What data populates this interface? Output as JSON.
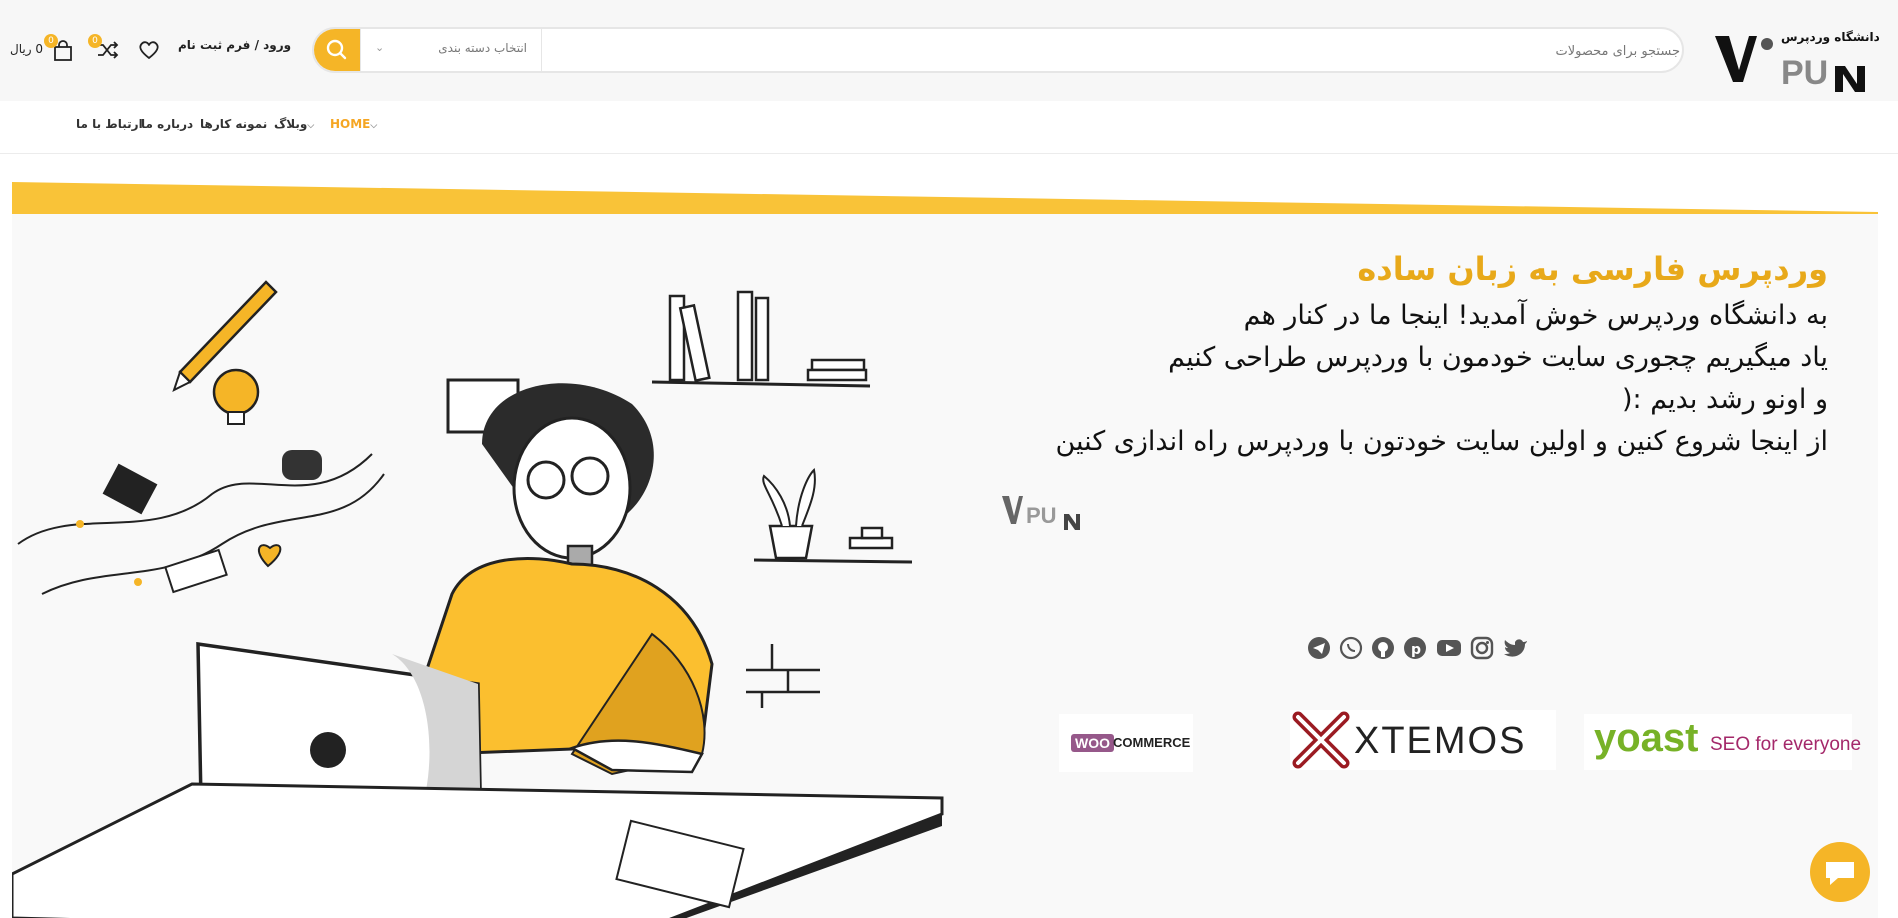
{
  "header": {
    "logo_text": "دانشگاه وردپرس",
    "search": {
      "placeholder": "جستجو برای محصولات",
      "category_label": "انتخاب دسته بندی"
    },
    "login_label": "ورود / فرم ثبت نام",
    "compare_count": "0",
    "cart_count": "0",
    "cart_total": "0 ریال"
  },
  "nav": {
    "items": [
      {
        "label": "HOME",
        "active": true
      },
      {
        "label": "وبلاگ"
      },
      {
        "label": "نمونه کارها"
      },
      {
        "label": "درباره ما"
      },
      {
        "label": "ارتباط با ما"
      }
    ]
  },
  "hero": {
    "title": "وردپرس فارسی به زبان ساده",
    "lines": [
      "به دانشگاه وردپرس خوش آمدید! اینجا ما در کنار هم",
      "یاد میگیریم چجوری سایت خودمون با وردپرس طراحی کنیم",
      "و اونو رشد بدیم :(",
      "از اینجا شروع کنین و اولین سایت خودتون با وردپرس راه اندازی کنین"
    ],
    "social_icons": [
      "telegram-icon",
      "whatsapp-icon",
      "github-icon",
      "pinterest-icon",
      "youtube-icon",
      "instagram-icon",
      "twitter-icon"
    ],
    "brands": [
      "WOO",
      "COMMERCE",
      "XTEMOS",
      "yoast",
      "SEO for everyone"
    ]
  },
  "colors": {
    "accent": "#f5b527",
    "title": "#e8a91a",
    "woo": "#96588a",
    "yoast_green": "#77b227",
    "yoast_purple": "#a4286a"
  }
}
